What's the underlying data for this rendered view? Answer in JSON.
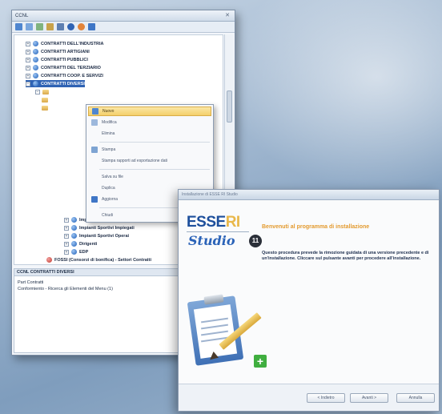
{
  "tree_window": {
    "title": "CCNL",
    "tree": [
      {
        "label": "CONTRATTI DELL'INDUSTRIA",
        "level": 1,
        "expanded": false
      },
      {
        "label": "CONTRATTI ARTIGIANI",
        "level": 1,
        "expanded": false
      },
      {
        "label": "CONTRATTI PUBBLICI",
        "level": 1,
        "expanded": false
      },
      {
        "label": "CONTRATTI DEL TERZIARIO",
        "level": 1,
        "expanded": false
      },
      {
        "label": "CONTRATTI COOP. E SERVIZI",
        "level": 1,
        "expanded": false
      },
      {
        "label": "CONTRATTI DIVERSI",
        "level": 1,
        "expanded": true,
        "selected": true
      },
      {
        "label": "Impiegati",
        "level": 2
      },
      {
        "label": "Impianti Sportivi Impiegati",
        "level": 2
      },
      {
        "label": "Impianti Sportivi Operai",
        "level": 2
      },
      {
        "label": "Dirigenti",
        "level": 2
      },
      {
        "label": "EDP",
        "level": 2
      },
      {
        "label": "FOSSI (Consorzi di bonifica) - Settori Contratti",
        "level": 1
      }
    ],
    "context_menu": [
      {
        "label": "Nuovo",
        "highlighted": true
      },
      {
        "label": "Modifica"
      },
      {
        "label": "Elimina"
      },
      {
        "label": "Stampa"
      },
      {
        "label": "Stampa rapporti ad esportazione dati"
      },
      {
        "label": "Salva su file"
      },
      {
        "label": "Duplica"
      },
      {
        "label": "Aggiorna"
      },
      {
        "label": "Chiudi"
      }
    ],
    "detail": {
      "header": "CCNL CONTRATTI DIVERSI",
      "lines": [
        "Part Contratti",
        "Conformiento - Ricerca gli Elementi del Menu (1)"
      ]
    }
  },
  "installer_window": {
    "title": "Installazione di ESSE RI Studio",
    "logo_brand": "ESSE",
    "logo_brand_accent": "RI",
    "logo_sub": "Studio",
    "logo_badge": "11",
    "heading": "Benvenuti al programma di installazione",
    "body": "Questo procedura prevede la rimozione guidata di una versione precedente e di un'installazione. Cliccare sul pulsante avanti per procedere all'installazione.",
    "buttons": {
      "back": "< Indietro",
      "next": "Avanti >",
      "cancel": "Annulla"
    }
  }
}
